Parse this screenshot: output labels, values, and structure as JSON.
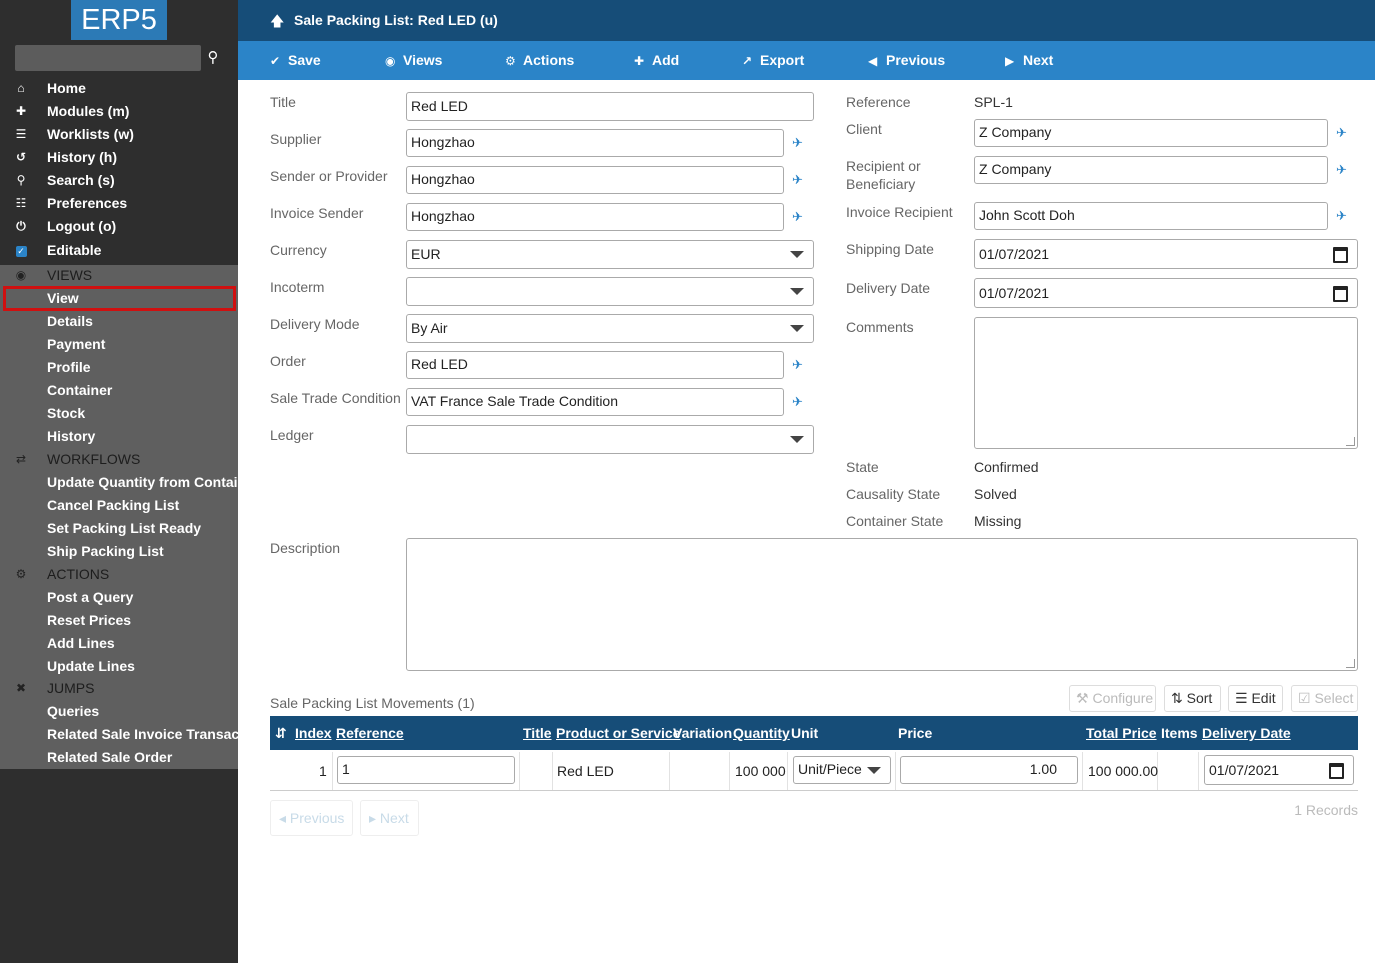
{
  "app": {
    "logo": "ERP5",
    "page_title": "Sale Packing List: Red LED (u)"
  },
  "sidebar": {
    "search_placeholder": "",
    "nav": [
      {
        "icon": "home-icon",
        "glyph": "⌂",
        "label": "Home"
      },
      {
        "icon": "puzzle-icon",
        "glyph": "✚",
        "label": "Modules (m)"
      },
      {
        "icon": "list-icon",
        "glyph": "☰",
        "label": "Worklists (w)"
      },
      {
        "icon": "history-icon",
        "glyph": "↺",
        "label": "History (h)"
      },
      {
        "icon": "search-icon",
        "glyph": "⚲",
        "label": "Search (s)"
      },
      {
        "icon": "sliders-icon",
        "glyph": "☷",
        "label": "Preferences"
      },
      {
        "icon": "power-icon",
        "glyph": "⏻",
        "label": "Logout (o)"
      },
      {
        "icon": "checkbox-icon",
        "glyph": "☑",
        "label": "Editable"
      }
    ],
    "views_header": "VIEWS",
    "views": [
      "View",
      "Details",
      "Payment",
      "Profile",
      "Container",
      "Stock",
      "History"
    ],
    "workflows_header": "WORKFLOWS",
    "workflows": [
      "Update Quantity from Container",
      "Cancel Packing List",
      "Set Packing List Ready",
      "Ship Packing List"
    ],
    "actions_header": "ACTIONS",
    "actions": [
      "Post a Query",
      "Reset Prices",
      "Add Lines",
      "Update Lines"
    ],
    "jumps_header": "JUMPS",
    "jumps": [
      "Queries",
      "Related Sale Invoice Transac...",
      "Related Sale Order"
    ]
  },
  "toolbar": {
    "save": "Save",
    "views": "Views",
    "actions": "Actions",
    "add": "Add",
    "export": "Export",
    "previous": "Previous",
    "next": "Next"
  },
  "form": {
    "title_label": "Title",
    "title_value": "Red LED",
    "supplier_label": "Supplier",
    "supplier_value": "Hongzhao",
    "sender_label": "Sender or Provider",
    "sender_value": "Hongzhao",
    "invoice_sender_label": "Invoice Sender",
    "invoice_sender_value": "Hongzhao",
    "currency_label": "Currency",
    "currency_value": "EUR",
    "incoterm_label": "Incoterm",
    "incoterm_value": "",
    "delivery_mode_label": "Delivery Mode",
    "delivery_mode_value": "By Air",
    "order_label": "Order",
    "order_value": "Red LED",
    "trade_condition_label": "Sale Trade Condition",
    "trade_condition_value": "VAT France Sale Trade Condition",
    "ledger_label": "Ledger",
    "ledger_value": "",
    "reference_label": "Reference",
    "reference_value": "SPL-1",
    "client_label": "Client",
    "client_value": "Z Company",
    "recipient_label_1": "Recipient or",
    "recipient_label_2": "Beneficiary",
    "recipient_value": "Z Company",
    "invoice_recipient_label": "Invoice Recipient",
    "invoice_recipient_value": "John Scott Doh",
    "shipping_date_label": "Shipping Date",
    "shipping_date_value": "01/07/2021",
    "delivery_date_label": "Delivery Date",
    "delivery_date_value": "01/07/2021",
    "comments_label": "Comments",
    "state_label": "State",
    "state_value": "Confirmed",
    "causality_label": "Causality State",
    "causality_value": "Solved",
    "container_state_label": "Container State",
    "container_state_value": "Missing",
    "description_label": "Description"
  },
  "listbox": {
    "title": "Sale Packing List Movements (1)",
    "configure": "Configure",
    "sort": "Sort",
    "edit": "Edit",
    "select": "Select",
    "columns": [
      "Index",
      "Reference",
      "Title",
      "Product or Service",
      "Variation",
      "Quantity",
      "Unit",
      "Price",
      "Total Price",
      "Items",
      "Delivery Date"
    ],
    "row": {
      "index": "1",
      "reference": "1",
      "title": "",
      "product": "Red LED",
      "variation": "",
      "quantity": "100 000",
      "unit": "Unit/Piece",
      "price": "1.00",
      "total_price": "100 000.00",
      "items": "",
      "delivery_date": "01/07/2021"
    },
    "previous": "Previous",
    "next": "Next",
    "records": "1 Records"
  }
}
